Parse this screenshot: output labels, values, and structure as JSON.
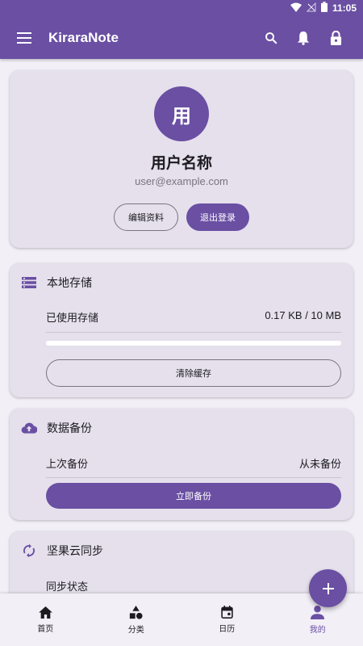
{
  "status_bar": {
    "time": "11:05"
  },
  "app_bar": {
    "title": "KiraraNote"
  },
  "profile": {
    "avatar_text": "用",
    "username": "用户名称",
    "email": "user@example.com",
    "edit_button": "编辑资料",
    "logout_button": "退出登录"
  },
  "storage": {
    "title": "本地存储",
    "used_label": "已使用存储",
    "used_value": "0.17 KB / 10 MB",
    "progress_fraction": 0.0,
    "clear_button": "清除缓存"
  },
  "backup": {
    "title": "数据备份",
    "last_label": "上次备份",
    "last_value": "从未备份",
    "backup_button": "立即备份"
  },
  "sync": {
    "title": "坚果云同步",
    "status_label": "同步状态"
  },
  "bottom_nav": {
    "items": [
      {
        "label": "首页",
        "icon": "home-icon"
      },
      {
        "label": "分类",
        "icon": "category-icon"
      },
      {
        "label": "日历",
        "icon": "calendar-icon"
      },
      {
        "label": "我的",
        "icon": "person-icon"
      }
    ],
    "active_index": 3
  },
  "colors": {
    "primary": "#6a4fa3",
    "card": "#e5e0ec",
    "background": "#f3eff7"
  }
}
